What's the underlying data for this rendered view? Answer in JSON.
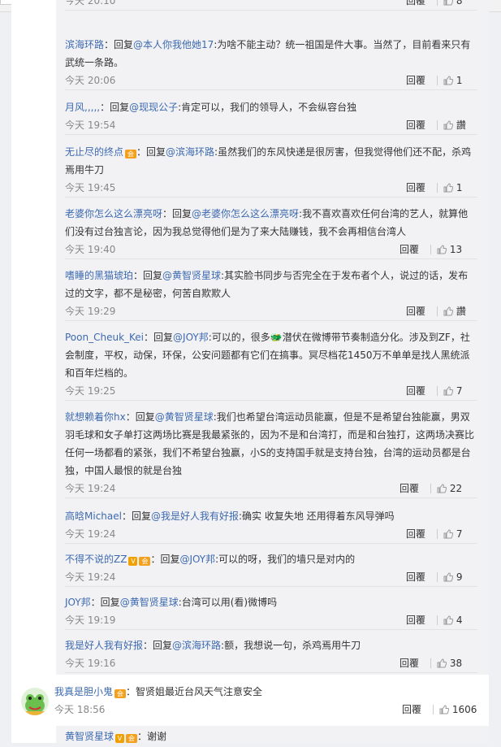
{
  "topbar": {
    "arrow": "˅"
  },
  "replies": [
    {
      "time": "今天 20:10",
      "reply_label": "回覆",
      "likes": "8",
      "user": "",
      "prefix": "",
      "target": "",
      "text": ""
    },
    {
      "time": "今天 20:06",
      "reply_label": "回覆",
      "likes": "1",
      "user": "滨海环路",
      "prefix": "：回复",
      "target": "@本人你我他她17",
      "text": ":为啥不能主动？统一祖国是件大事。当然了，目前看来只有武统一条路。"
    },
    {
      "time": "今天 19:54",
      "reply_label": "回覆",
      "likes": "讚",
      "user": "月风,,,,,",
      "prefix": "：回复",
      "target": "@现现公子",
      "text": ":肯定可以，我们的领导人，不会纵容台独"
    },
    {
      "time": "今天 19:45",
      "reply_label": "回覆",
      "likes": "1",
      "user": "无止尽的终点",
      "badge": "会",
      "prefix": "：回复",
      "target": "@滨海环路",
      "text": ":虽然我们的东风快递是很厉害，但我觉得他们还不配，杀鸡焉用牛刀"
    },
    {
      "time": "今天 19:40",
      "reply_label": "回覆",
      "likes": "13",
      "user": "老婆你怎么这么漂亮呀",
      "prefix": "：回复",
      "target": "@老婆你怎么这么漂亮呀",
      "text": ":我不喜欢喜欢任何台湾的艺人，就算他们没有过台独言论，因为我总觉得他们是为了来大陆赚钱，我不会再相信台湾人"
    },
    {
      "time": "今天 19:29",
      "reply_label": "回覆",
      "likes": "讚",
      "user": "嗜睡的黑猫琥珀",
      "prefix": "：回复",
      "target": "@黄智贤星球",
      "text": ":其实脸书同步与否完全在于发布者个人，说过的话，发布过的文字，都不是秘密，何苦自欺欺人"
    },
    {
      "time": "今天 19:25",
      "reply_label": "回覆",
      "likes": "7",
      "user": "Poon_Cheuk_Kei",
      "prefix": "：回复",
      "target": "@JOY邦",
      "text": ":可以的，很多🐲潜伏在微博带节奏制造分化。涉及到ZF，社会制度，平权，动保，环保，公安问题都有它们在搞事。冥尽档花1450万不单单是找人黑统派和百年烂档的。"
    },
    {
      "time": "今天 19:24",
      "reply_label": "回覆",
      "likes": "22",
      "user": "就想赖着你hx",
      "prefix": "：回复",
      "target": "@黄智贤星球",
      "text": ":我们也希望台湾运动员能赢，但是不是希望台独能赢，男双羽毛球和女子单打这两场比赛是我最紧张的，因为不是和台湾打，而是和台独打，这两场决赛比任何一场都看的紧张，我们不希望台独赢，小S的支持国手就是支持台独，台湾的运动员都是台独，中国人最恨的就是台独"
    },
    {
      "time": "今天 19:24",
      "reply_label": "回覆",
      "likes": "7",
      "user": "高晗Michael",
      "prefix": "：回复",
      "target": "@我是好人我有好报",
      "text": ":确实 收复失地 还用得着东风导弹吗"
    },
    {
      "time": "今天 19:24",
      "reply_label": "回覆",
      "likes": "9",
      "user": "不得不说的ZZ",
      "badge_v": "V",
      "badge": "会",
      "prefix": "：回复",
      "target": "@JOY邦",
      "text": ":可以的呀，我们的墙只是对内的"
    },
    {
      "time": "今天 19:19",
      "reply_label": "回覆",
      "likes": "4",
      "user": "JOY邦",
      "prefix": "：回复",
      "target": "@黄智贤星球",
      "text": ":台湾可以用(看)微博吗"
    },
    {
      "time": "今天 19:16",
      "reply_label": "回覆",
      "likes": "38",
      "user": "我是好人我有好报",
      "prefix": "：回复",
      "target": "@滨海环路",
      "text": ":额，我想说一句，杀鸡焉用牛刀"
    }
  ],
  "top_comment": {
    "user": "我真是胆小鬼",
    "badge": "会",
    "text": "：智贤姐最近台风天气注意安全",
    "time": "今天 18:56",
    "reply_label": "回覆",
    "likes": "1606"
  },
  "partial_comment": {
    "user": "黄智贤星球",
    "badge_v": "V",
    "badge": "会",
    "text": "：谢谢"
  }
}
